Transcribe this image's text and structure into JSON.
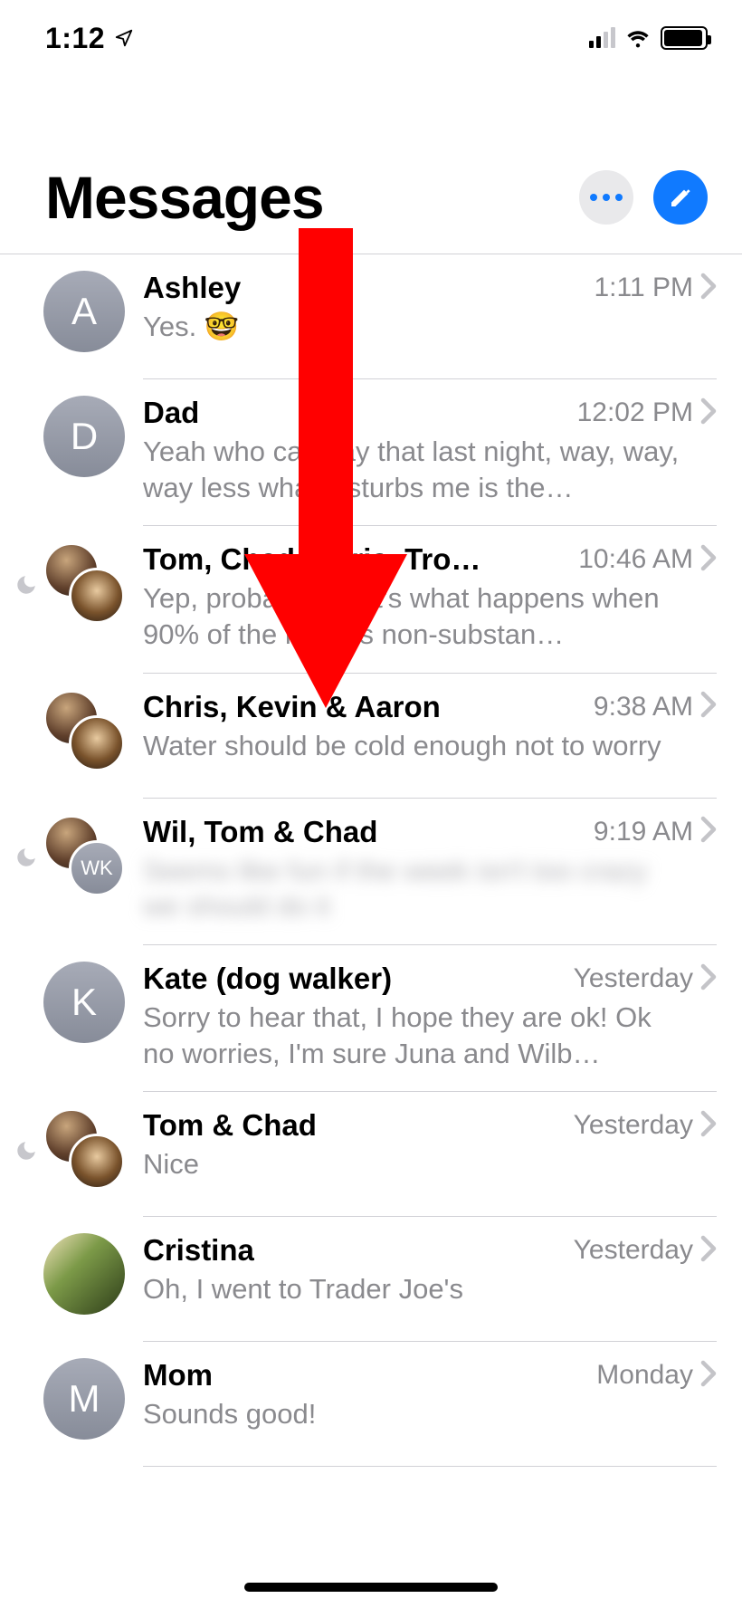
{
  "status": {
    "time": "1:12"
  },
  "header": {
    "title": "Messages"
  },
  "conversations": [
    {
      "name": "Ashley",
      "time": "1:11 PM",
      "preview": "Yes. 🤓",
      "avatar_type": "initial",
      "initial": "A",
      "dnd": false,
      "group": false,
      "blurred": false
    },
    {
      "name": "Dad",
      "time": "12:02 PM",
      "preview": "Yeah who can say that last night, way, way, way less what disturbs me is the…",
      "avatar_type": "initial",
      "initial": "D",
      "dnd": false,
      "group": false,
      "blurred": false
    },
    {
      "name": "Tom, Chad, Chris, Tro…",
      "time": "10:46 AM",
      "preview": "Yep, probably. That's what happens when 90% of the night is non-substan…",
      "avatar_type": "photo",
      "dnd": true,
      "group": true,
      "blurred": false
    },
    {
      "name": "Chris, Kevin & Aaron",
      "time": "9:38 AM",
      "preview": "Water should be cold enough not to worry",
      "avatar_type": "photo",
      "dnd": false,
      "group": true,
      "blurred": false
    },
    {
      "name": "Wil, Tom & Chad",
      "time": "9:19 AM",
      "preview": "Seems like fun if the week isn't too crazy we should do it",
      "avatar_type": "photo_wk",
      "dnd": true,
      "group": true,
      "blurred": true
    },
    {
      "name": "Kate (dog walker)",
      "time": "Yesterday",
      "preview": "Sorry to hear that, I hope they are ok! Ok no worries, I'm sure Juna and Wilb…",
      "avatar_type": "initial",
      "initial": "K",
      "dnd": false,
      "group": false,
      "blurred": false
    },
    {
      "name": "Tom & Chad",
      "time": "Yesterday",
      "preview": "Nice",
      "avatar_type": "photo",
      "dnd": true,
      "group": true,
      "blurred": false
    },
    {
      "name": "Cristina",
      "time": "Yesterday",
      "preview": "Oh, I went to Trader Joe's",
      "avatar_type": "photo_single",
      "dnd": false,
      "group": false,
      "blurred": false
    },
    {
      "name": "Mom",
      "time": "Monday",
      "preview": "Sounds good!",
      "avatar_type": "initial",
      "initial": "M",
      "dnd": false,
      "group": false,
      "blurred": false
    }
  ],
  "annotation": {
    "arrow_color": "#ff0000"
  }
}
